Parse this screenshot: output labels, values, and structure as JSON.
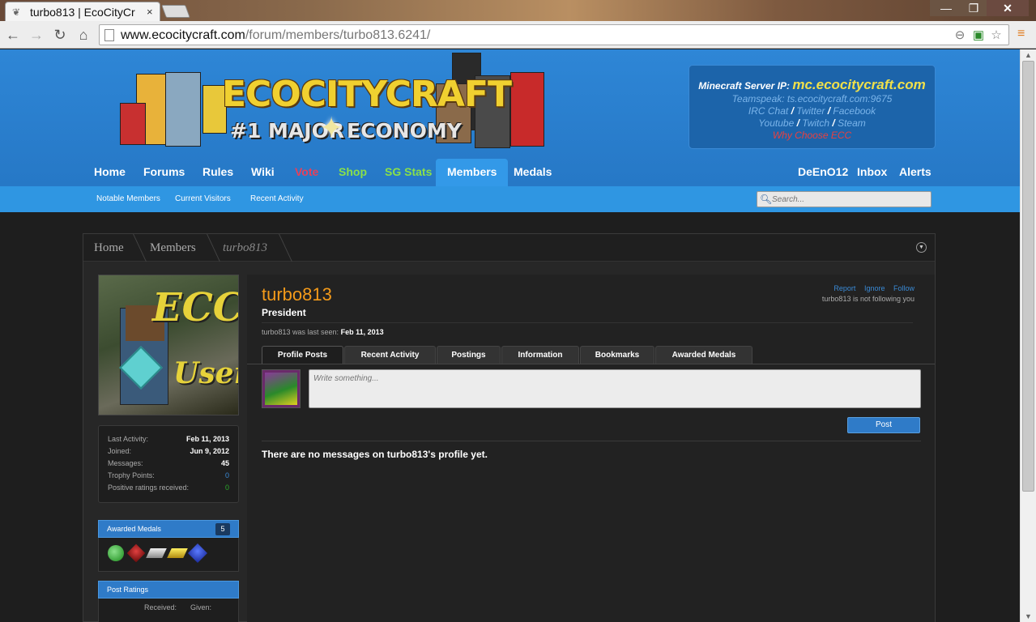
{
  "browser": {
    "tab_title": "turbo813 | EcoCityCr",
    "tab_close": "×",
    "url_host": "www.ecocitycraft.com",
    "url_path": "/forum/members/turbo813.6241/",
    "win_min": "—",
    "win_max": "❐",
    "win_close": "✕"
  },
  "site": {
    "logo_title": "ECOCITYCRAFT",
    "logo_sub_left": "#1 MAJOR",
    "logo_sub_right": "ECONOMY",
    "server": {
      "ip_label": "Minecraft Server IP:",
      "ip_value": "mc.ecocitycraft.com",
      "teamspeak": "Teamspeak: ts.ecocitycraft.com:9675",
      "irc": "IRC Chat",
      "twitter": "Twitter",
      "facebook": "Facebook",
      "youtube": "Youtube",
      "twitch": "Twitch",
      "steam": "Steam",
      "why": "Why Choose ECC",
      "sep": "/"
    }
  },
  "nav": {
    "home": "Home",
    "forums": "Forums",
    "rules": "Rules",
    "wiki": "Wiki",
    "vote": "Vote",
    "shop": "Shop",
    "sgstats": "SG Stats",
    "members": "Members",
    "medals": "Medals",
    "user": "DeEnO12",
    "inbox": "Inbox",
    "alerts": "Alerts",
    "colors": {
      "vote": "#e8405a",
      "shop": "#8ae04a",
      "sgstats": "#8ae04a"
    }
  },
  "subnav": {
    "notable": "Notable Members",
    "visitors": "Current Visitors",
    "recent": "Recent Activity",
    "search_placeholder": "Search..."
  },
  "breadcrumb": {
    "home": "Home",
    "members": "Members",
    "current": "turbo813"
  },
  "sidebar": {
    "avatar_text1": "ECC",
    "avatar_text2": "User",
    "stats": [
      {
        "label": "Last Activity:",
        "value": "Feb 11, 2013"
      },
      {
        "label": "Joined:",
        "value": "Jun 9, 2012"
      },
      {
        "label": "Messages:",
        "value": "45"
      },
      {
        "label": "Trophy Points:",
        "value": "0"
      },
      {
        "label": "Positive ratings received:",
        "value": "0"
      }
    ],
    "medals_title": "Awarded Medals",
    "medals_count": "5",
    "medals": [
      "emerald-icon",
      "redstone-icon",
      "iron-ingot-icon",
      "gold-ingot-icon",
      "lapis-icon"
    ],
    "ratings_title": "Post Ratings",
    "ratings_received": "Received:",
    "ratings_given": "Given:"
  },
  "profile": {
    "username": "turbo813",
    "title": "President",
    "report": "Report",
    "ignore": "Ignore",
    "follow": "Follow",
    "follow_status": "turbo813 is not following you",
    "last_seen_label": "turbo813 was last seen:",
    "last_seen_value": "Feb 11, 2013",
    "tabs": [
      "Profile Posts",
      "Recent Activity",
      "Postings",
      "Information",
      "Bookmarks",
      "Awarded Medals"
    ],
    "post_placeholder": "Write something...",
    "post_button": "Post",
    "no_messages": "There are no messages on turbo813's profile yet."
  }
}
